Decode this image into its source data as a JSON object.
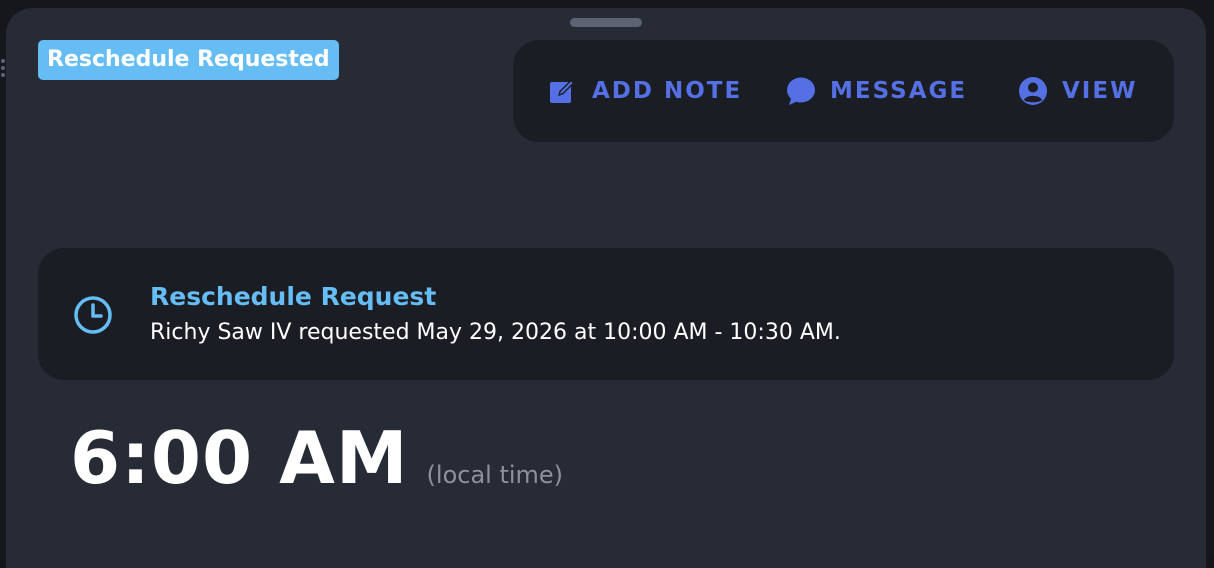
{
  "status_badge": {
    "label": "Reschedule Requested",
    "color": "#66bdf3"
  },
  "actions": {
    "add_note": {
      "label": "ADD NOTE",
      "icon": "edit-note-icon"
    },
    "message": {
      "label": "MESSAGE",
      "icon": "chat-bubble-icon"
    },
    "view": {
      "label": "VIEW",
      "icon": "user-circle-icon"
    },
    "accent_color": "#5470e4"
  },
  "reschedule_card": {
    "icon": "clock-icon",
    "title": "Reschedule Request",
    "text": "Richy Saw IV requested May 29, 2026 at 10:00 AM - 10:30 AM."
  },
  "appointment_time": {
    "time": "6:00 AM",
    "note": "(local time)"
  }
}
